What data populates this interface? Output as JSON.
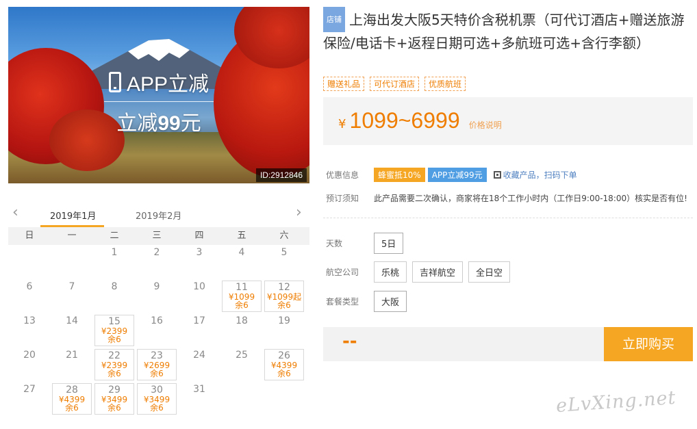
{
  "hero": {
    "app_label": "APP立减",
    "discount_label_prefix": "立减",
    "discount_amount": "99",
    "discount_suffix": "元",
    "id_badge": "ID:2912846"
  },
  "calendar": {
    "tabs": [
      "2019年1月",
      "2019年2月"
    ],
    "active_tab": 0,
    "weekdays": [
      "日",
      "一",
      "二",
      "三",
      "四",
      "五",
      "六"
    ],
    "days": [
      {
        "day": ""
      },
      {
        "day": ""
      },
      {
        "day": "1"
      },
      {
        "day": "2"
      },
      {
        "day": "3"
      },
      {
        "day": "4"
      },
      {
        "day": "5"
      },
      {
        "day": "6"
      },
      {
        "day": "7"
      },
      {
        "day": "8"
      },
      {
        "day": "9"
      },
      {
        "day": "10"
      },
      {
        "day": "11",
        "price": "¥1099",
        "remain": "余6"
      },
      {
        "day": "12",
        "price": "¥1099起",
        "remain": "余6"
      },
      {
        "day": "13"
      },
      {
        "day": "14"
      },
      {
        "day": "15",
        "price": "¥2399",
        "remain": "余6"
      },
      {
        "day": "16"
      },
      {
        "day": "17"
      },
      {
        "day": "18"
      },
      {
        "day": "19"
      },
      {
        "day": "20"
      },
      {
        "day": "21"
      },
      {
        "day": "22",
        "price": "¥2399",
        "remain": "余6"
      },
      {
        "day": "23",
        "price": "¥2699",
        "remain": "余6"
      },
      {
        "day": "24"
      },
      {
        "day": "25"
      },
      {
        "day": "26",
        "price": "¥4399",
        "remain": "余6"
      },
      {
        "day": "27"
      },
      {
        "day": "28",
        "price": "¥4399",
        "remain": "余6"
      },
      {
        "day": "29",
        "price": "¥3499",
        "remain": "余6"
      },
      {
        "day": "30",
        "price": "¥3499",
        "remain": "余6"
      },
      {
        "day": "31"
      }
    ]
  },
  "product": {
    "shop_badge": "店铺",
    "title": "上海出发大阪5天特价含税机票（可代订酒店+赠送旅游保险/电话卡+返程日期可选+多航班可选+含行李额）",
    "tags": [
      "赠送礼品",
      "可代订酒店",
      "优质航班"
    ],
    "price_yen": "¥",
    "price_range": "1099~6999",
    "price_note": "价格说明"
  },
  "offers": {
    "label": "优惠信息",
    "badge_bee": "蜂蜜抵10%",
    "badge_app": "APP立减99元",
    "collect_text": "收藏产品，扫码下单"
  },
  "notice": {
    "label": "预订须知",
    "text": "此产品需要二次确认，商家将在18个工作小时内（工作日9:00-18:00）核实是否有位!"
  },
  "options": {
    "days_label": "天数",
    "days": [
      "5日"
    ],
    "airline_label": "航空公司",
    "airlines": [
      "乐桃",
      "吉祥航空",
      "全日空"
    ],
    "package_label": "套餐类型",
    "packages": [
      "大阪"
    ]
  },
  "buy": {
    "total": "--",
    "button": "立即购买"
  },
  "watermark": "eLvXing.net"
}
